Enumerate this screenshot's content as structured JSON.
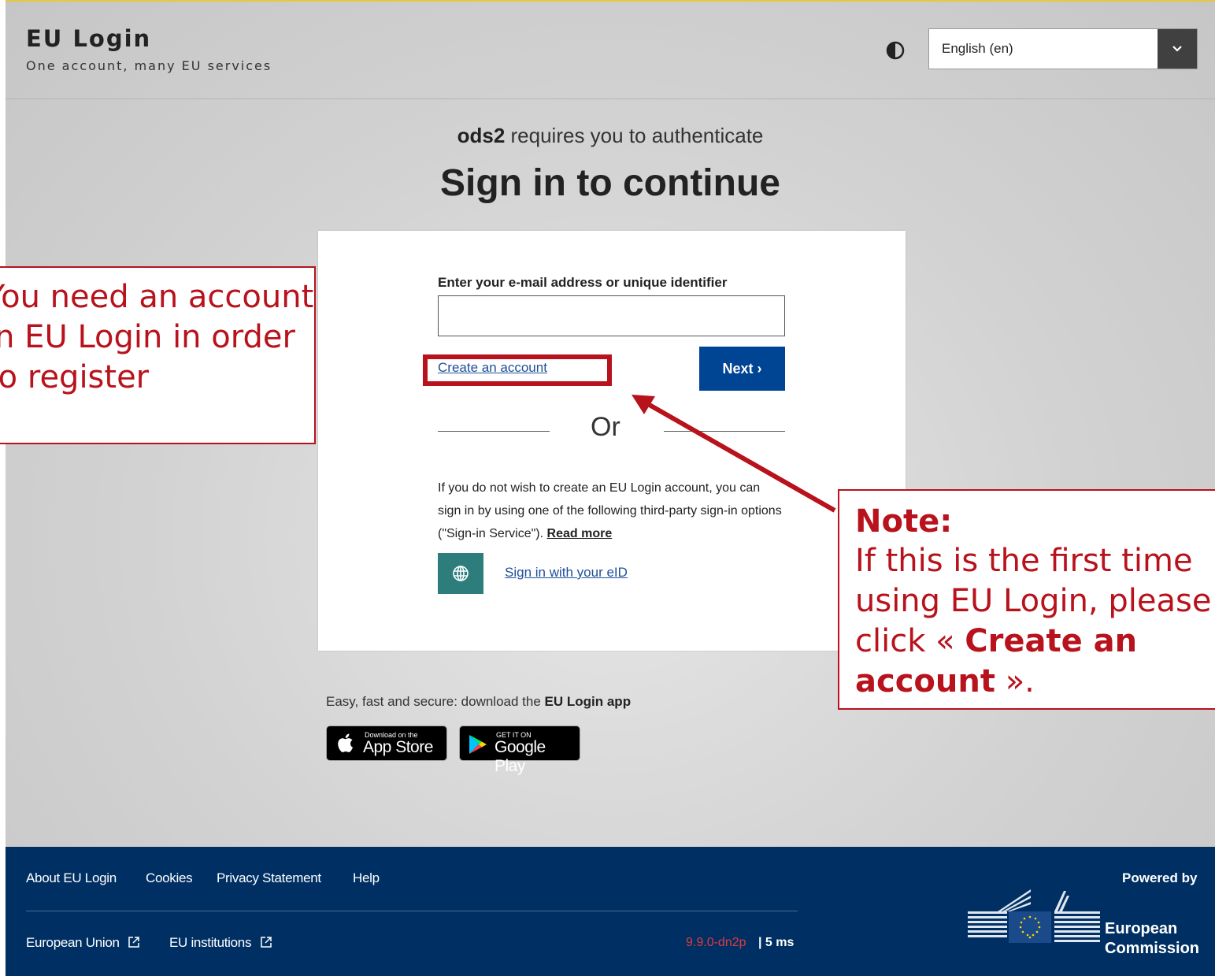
{
  "header": {
    "title": "EU Login",
    "subtitle": "One account, many EU services",
    "language": "English (en)"
  },
  "main": {
    "requires_app": "ods2",
    "requires_text": "requires you to authenticate",
    "heading": "Sign in to continue",
    "email_label": "Enter your e-mail address or unique identifier",
    "email_value": "",
    "create_account": "Create an account",
    "next_button": "Next",
    "next_chevron": "›",
    "or": "Or",
    "third_party_text": "If you do not wish to create an EU Login account, you can sign in by using one of the following third-party sign-in options (\"Sign-in Service\").",
    "read_more": "Read more",
    "eid_link": "Sign in with your eID",
    "app_promo_prefix": "Easy, fast and secure: download the",
    "app_promo_name": "EU Login app",
    "app_store_small": "Download on the",
    "app_store_big": "App Store",
    "google_play_small": "GET IT ON",
    "google_play_big": "Google Play"
  },
  "footer": {
    "links": [
      "About EU Login",
      "Cookies",
      "Privacy Statement",
      "Help"
    ],
    "external_links": [
      "European Union",
      "EU institutions"
    ],
    "version": "9.9.0-dn2p",
    "timing": "| 5 ms",
    "powered_by": "Powered by",
    "ec_line1": "European",
    "ec_line2": "Commission"
  },
  "annotations": {
    "left_callout": "You need an account in EU Login in order to register",
    "note_title": "Note:",
    "note_body_prefix": "If this is the first time using EU Login, please click «",
    "note_body_bold": "Create an account",
    "note_body_suffix": "».",
    "color": "#b8121c"
  },
  "colors": {
    "primary": "#004494",
    "footer_bg": "#003063",
    "eid_teal": "#2d7d7d",
    "link": "#1f4f9a"
  }
}
